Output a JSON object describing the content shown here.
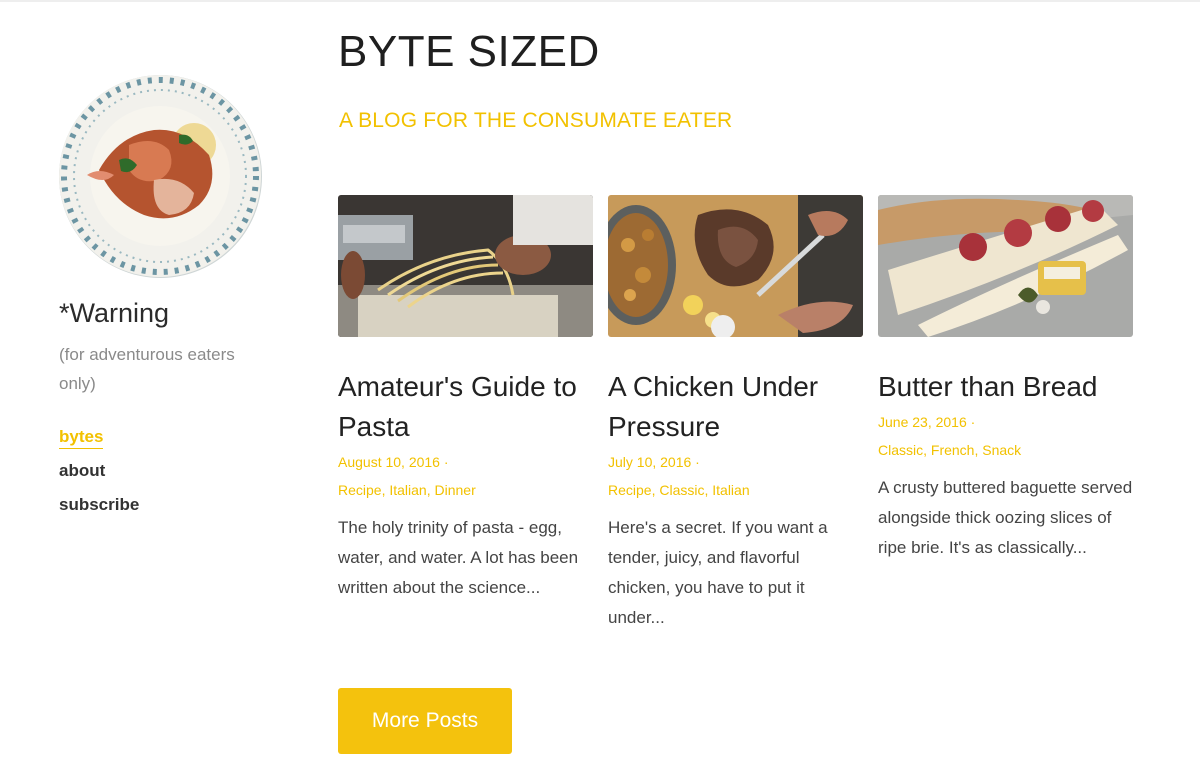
{
  "header": {
    "title": "BYTE SIZED",
    "tagline": "A BLOG FOR THE CONSUMATE EATER"
  },
  "sidebar": {
    "warning": "*Warning",
    "subtitle": "(for adventurous eaters only)",
    "nav": [
      {
        "label": "bytes",
        "active": true
      },
      {
        "label": "about",
        "active": false
      },
      {
        "label": "subscribe",
        "active": false
      }
    ]
  },
  "posts": [
    {
      "title": "Amateur's Guide to Pasta",
      "date": "August 10, 2016 ·",
      "tags": "Recipe, Italian, Dinner",
      "excerpt": "The holy trinity of pasta - egg, water, and water. A lot has been written about the science..."
    },
    {
      "title": "A Chicken Under Pressure",
      "date": "July 10, 2016 ·",
      "tags": "Recipe, Classic, Italian",
      "excerpt": "Here's a secret. If you want a tender, juicy, and flavorful chicken, you have to put it under..."
    },
    {
      "title": "Butter than Bread",
      "date": "June 23, 2016 ·",
      "tags": "Classic, French, Snack",
      "excerpt": "A crusty buttered baguette served alongside thick oozing slices of ripe brie. It's as classically..."
    }
  ],
  "more_button": "More Posts",
  "colors": {
    "accent": "#f2c100",
    "button": "#f4c20d"
  }
}
